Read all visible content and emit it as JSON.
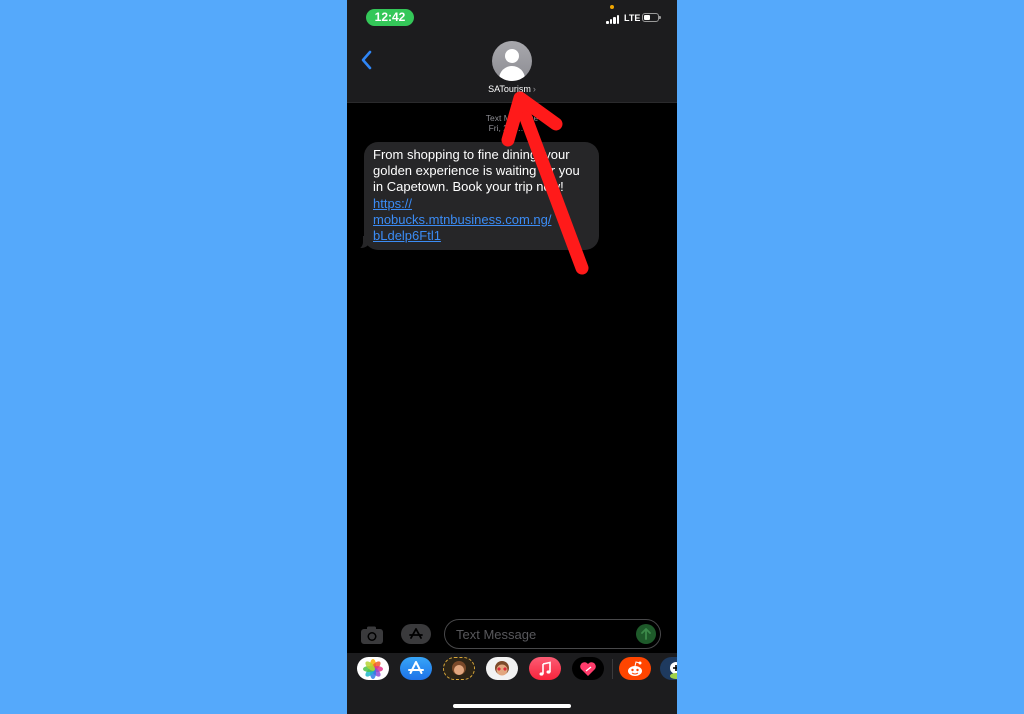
{
  "status_bar": {
    "time": "12:42",
    "network": "LTE",
    "battery_level": 0.45
  },
  "header": {
    "back_icon": "chevron-left-icon",
    "contact_name": "SATourism",
    "contact_chevron": "›",
    "avatar_icon": "person-silhouette-icon"
  },
  "conversation": {
    "meta_line1": "Text Message",
    "meta_line2": "Fri, 25 … 53",
    "messages": [
      {
        "direction": "incoming",
        "text": "From shopping to fine dining, your golden experience is waiting for you in Capetown. Book your trip now!",
        "link_line1": "https://",
        "link_line2": "mobucks.mtnbusiness.com.ng/",
        "link_line3": "bLdelp6Ftl1"
      }
    ]
  },
  "compose": {
    "placeholder": "Text Message",
    "camera_icon": "camera-icon",
    "appstore_icon": "app-store-icon",
    "send_icon": "arrow-up-icon"
  },
  "app_drawer": {
    "apps": [
      {
        "name": "Photos",
        "icon": "photos-icon"
      },
      {
        "name": "App Store",
        "icon": "app-store-icon"
      },
      {
        "name": "Memoji",
        "icon": "memoji-icon"
      },
      {
        "name": "Memoji Stickers",
        "icon": "memoji-stickers-icon"
      },
      {
        "name": "Music",
        "icon": "music-icon"
      },
      {
        "name": "Digital Touch",
        "icon": "digital-touch-icon"
      },
      {
        "name": "Reddit",
        "icon": "reddit-icon"
      },
      {
        "name": "Other App",
        "icon": "app-icon"
      }
    ]
  },
  "annotation": {
    "type": "red-arrow",
    "points_to": "contact-name",
    "color": "#ff1a1a"
  },
  "colors": {
    "background": "#55a9fb",
    "time_pill": "#34c759",
    "link": "#3b8cf5",
    "bubble": "#262628"
  }
}
